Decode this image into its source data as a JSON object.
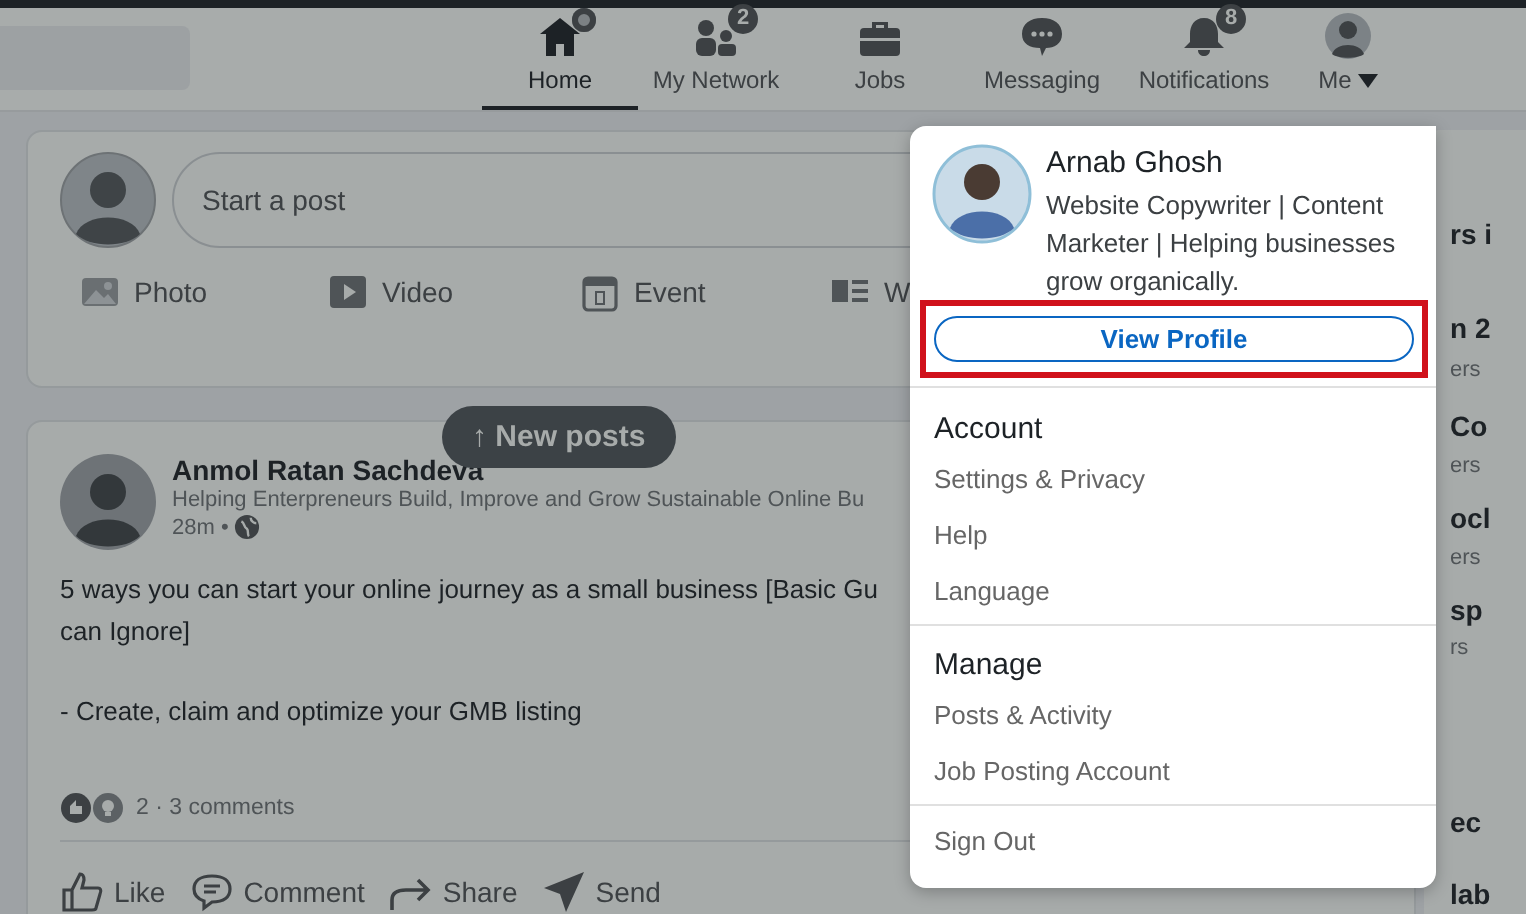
{
  "nav": {
    "items": [
      {
        "label": "Home",
        "kind": "home",
        "selected": true,
        "dot": true
      },
      {
        "label": "My Network",
        "kind": "network",
        "selected": false,
        "badge": "2"
      },
      {
        "label": "Jobs",
        "kind": "jobs",
        "selected": false
      },
      {
        "label": "Messaging",
        "kind": "messaging",
        "selected": false
      },
      {
        "label": "Notifications",
        "kind": "notifications",
        "selected": false,
        "badge": "8"
      },
      {
        "label": "Me",
        "kind": "me",
        "selected": false
      }
    ]
  },
  "composer": {
    "placeholder": "Start a post",
    "actions": [
      {
        "label": "Photo",
        "kind": "photo"
      },
      {
        "label": "Video",
        "kind": "video"
      },
      {
        "label": "Event",
        "kind": "event"
      },
      {
        "label": "W",
        "kind": "article"
      }
    ]
  },
  "new_posts": "↑ New posts",
  "post": {
    "author": "Anmol Ratan Sachdeva",
    "headline": "Helping Enterpreneurs Build, Improve and Grow Sustainable Online Bu",
    "time": "28m •",
    "body": [
      "5 ways you can start your online journey as a small business [Basic Gu",
      "can Ignore]",
      "- Create, claim and optimize your GMB listing"
    ],
    "reactions": "2 · 3 comments",
    "actions": [
      {
        "label": "Like",
        "kind": "like"
      },
      {
        "label": "Comment",
        "kind": "comment"
      },
      {
        "label": "Share",
        "kind": "share"
      },
      {
        "label": "Send",
        "kind": "send"
      }
    ]
  },
  "right_column": [
    {
      "text": "rs i",
      "kind": "title"
    },
    {
      "text": "n 2",
      "kind": "title"
    },
    {
      "text": "ers",
      "kind": "sub"
    },
    {
      "text": "Co",
      "kind": "title"
    },
    {
      "text": "ers",
      "kind": "sub"
    },
    {
      "text": "ocl",
      "kind": "title"
    },
    {
      "text": "ers",
      "kind": "sub"
    },
    {
      "text": "sp",
      "kind": "title"
    },
    {
      "text": "rs",
      "kind": "sub"
    },
    {
      "text": "ec",
      "kind": "title"
    },
    {
      "text": "lab",
      "kind": "title"
    }
  ],
  "menu": {
    "name": "Arnab Ghosh",
    "headline": "Website Copywriter | Content Marketer | Helping businesses grow organically.",
    "view_profile": {
      "label": "View Profile",
      "highlighted": true
    },
    "sections": [
      {
        "title": "Account",
        "items": [
          "Settings & Privacy",
          "Help",
          "Language"
        ]
      },
      {
        "title": "Manage",
        "items": [
          "Posts & Activity",
          "Job Posting Account"
        ]
      }
    ],
    "sign_out": "Sign Out"
  }
}
